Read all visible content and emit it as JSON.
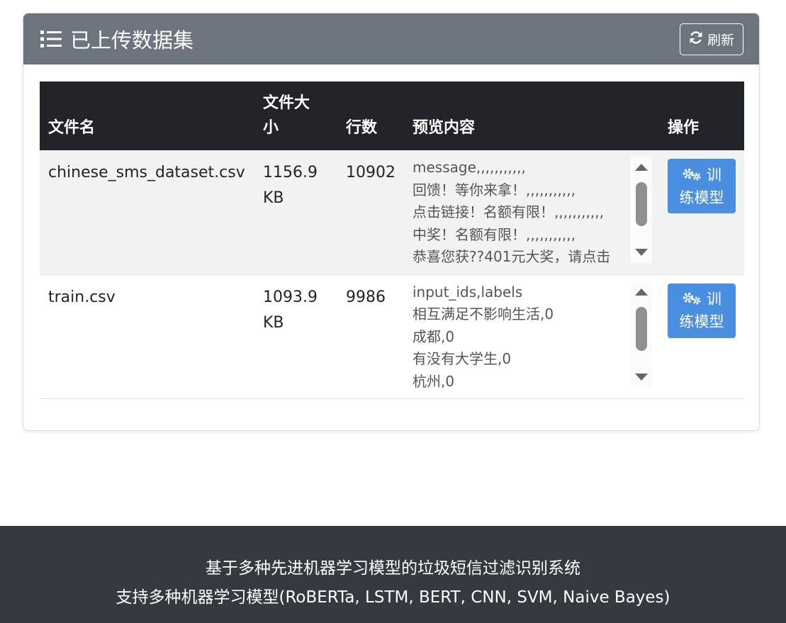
{
  "card": {
    "title": "已上传数据集",
    "refresh_label": "刷新"
  },
  "table": {
    "headers": {
      "filename": "文件名",
      "size_line1": "文件大",
      "size_line2": "小",
      "rows": "行数",
      "preview": "预览内容",
      "actions": "操作"
    },
    "rows": [
      {
        "filename": "chinese_sms_dataset.csv",
        "size_value": "1156.9",
        "size_unit": "KB",
        "row_count": "10902",
        "preview": "message,,,,,,,,,,,\n回馈！等你来拿！,,,,,,,,,,,\n点击链接！名额有限！,,,,,,,,,,,\n中奖！名额有限！,,,,,,,,,,,\n恭喜您获??401元大奖，请点击",
        "action_line1": "训",
        "action_line2": "练模型"
      },
      {
        "filename": "train.csv",
        "size_value": "1093.9",
        "size_unit": "KB",
        "row_count": "9986",
        "preview": "input_ids,labels\n相互满足不影响生活,0\n成都,0\n有没有大学生,0\n杭州,0",
        "action_line1": "训",
        "action_line2": "练模型"
      }
    ]
  },
  "footer": {
    "line1": "基于多种先进机器学习模型的垃圾短信过滤识别系统",
    "line2": "支持多种机器学习模型(RoBERTa, LSTM, BERT, CNN, SVM, Naive Bayes)"
  },
  "colors": {
    "header_bg": "#6c757d",
    "table_head_bg": "#212529",
    "button_primary": "#4a8ee0",
    "footer_bg": "#343a40"
  },
  "icons": {
    "title_icon": "list-icon",
    "refresh_icon": "sync-icon",
    "train_icon": "cogs-icon"
  }
}
